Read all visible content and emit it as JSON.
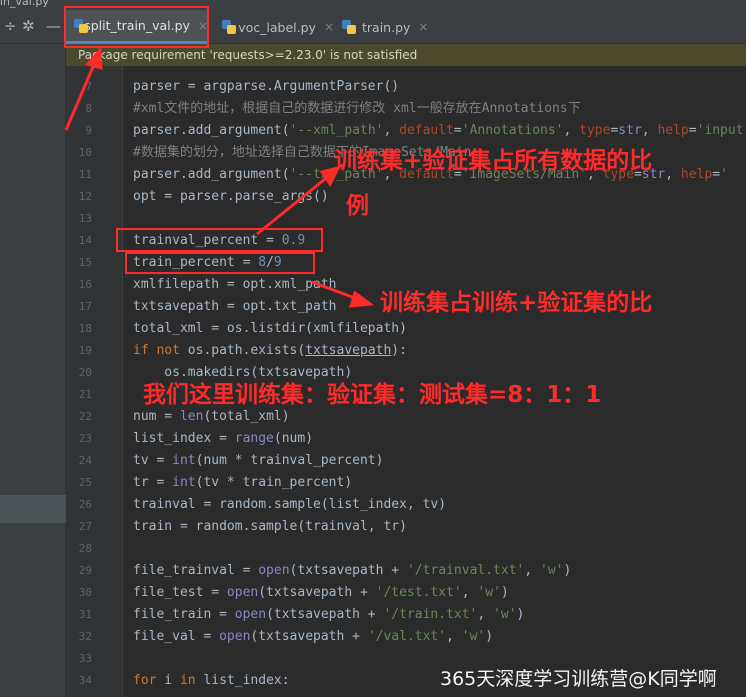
{
  "window": {
    "title_fragment": "in_val.py"
  },
  "toolbar": {
    "icons": [
      "gear-icon",
      "minimize-icon"
    ]
  },
  "tabs": [
    {
      "label": "split_train_val.py",
      "active": true,
      "icon": "python-file-icon",
      "close": "×"
    },
    {
      "label": "voc_label.py",
      "active": false,
      "icon": "python-file-icon",
      "close": "×"
    },
    {
      "label": "train.py",
      "active": false,
      "icon": "python-file-icon",
      "close": "×"
    }
  ],
  "banner": {
    "text": "Package requirement 'requests>=2.23.0' is not satisfied"
  },
  "line_numbers": [
    "7",
    "8",
    "9",
    "10",
    "11",
    "12",
    "13",
    "14",
    "15",
    "16",
    "17",
    "18",
    "19",
    "20",
    "21",
    "22",
    "23",
    "24",
    "25",
    "26",
    "27",
    "28",
    "29",
    "30",
    "31",
    "32",
    "33",
    "34"
  ],
  "annotations": {
    "a1_line1": "训练集+验证集占所有数据的比",
    "a1_line2": "例",
    "a2": "训练集占训练+验证集的比",
    "a3": "我们这里训练集：验证集：测试集=8：1：1",
    "watermark": "365天深度学习训练营@K同学啊"
  },
  "colors": {
    "annotation": "#ff2a2a",
    "keyword": "#cc7832",
    "string": "#6a8759",
    "number": "#6897bb",
    "comment": "#808080",
    "accent": "#4a88c7"
  }
}
